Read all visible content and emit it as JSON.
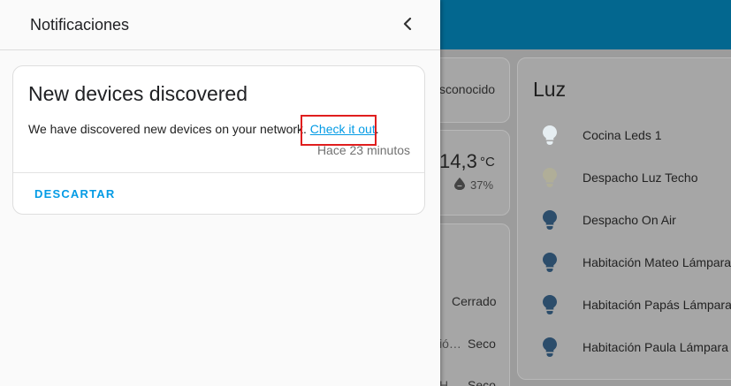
{
  "drawer": {
    "title": "Notificaciones",
    "close_icon": "chevron-left-icon"
  },
  "notification": {
    "title": "New devices discovered",
    "body_text": "We have discovered new devices on your network. ",
    "link_text": "Check it out",
    "body_end": ".",
    "time": "Hace 23 minutos",
    "dismiss_label": "DESCARTAR"
  },
  "background": {
    "status_text": "sconocido",
    "temperature": "14,3",
    "temperature_unit": "°C",
    "humidity": "37%",
    "humidity_icon": "water-drop-icon",
    "row_cerrado": "Cerrado",
    "row_partial_1": "ió…",
    "row_seco_1": "Seco",
    "row_partial_2": "H…",
    "row_seco_2": "Seco",
    "luz_card": {
      "title": "Luz",
      "lights": [
        {
          "name": "Cocina Leds 1",
          "state": "on",
          "icon_color": "#e6eef2"
        },
        {
          "name": "Despacho Luz Techo",
          "state": "on",
          "icon_color": "#b0ae98"
        },
        {
          "name": "Despacho On Air",
          "state": "off",
          "icon_color": "#2c4d6b"
        },
        {
          "name": "Habitación Mateo Lámpara",
          "state": "off",
          "icon_color": "#2c4d6b"
        },
        {
          "name": "Habitación Papás Lámpara",
          "state": "off",
          "icon_color": "#2c4d6b"
        },
        {
          "name": "Habitación Paula Lámpara",
          "state": "off",
          "icon_color": "#2c4d6b"
        }
      ]
    }
  },
  "colors": {
    "header": "#03678f",
    "link": "#039be5",
    "highlight": "#e01e1e"
  }
}
